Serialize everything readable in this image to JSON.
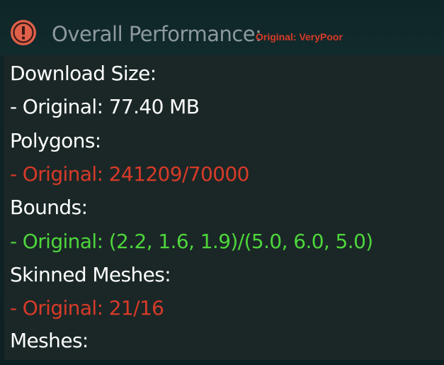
{
  "header": {
    "icon": "exclamation-circle-icon",
    "title": "Overall Performance:",
    "rating": "Original: VeryPoor",
    "rating_color": "#d83a28"
  },
  "stats": [
    {
      "label": "Download Size:",
      "value": "- Original: 77.40 MB",
      "value_color": "#ffffff"
    },
    {
      "label": "Polygons:",
      "value": "- Original: 241209/70000",
      "value_color": "#d83a28"
    },
    {
      "label": "Bounds:",
      "value": "- Original: (2.2, 1.6, 1.9)/(5.0, 6.0, 5.0)",
      "value_color": "#4ed63c"
    },
    {
      "label": "Skinned Meshes:",
      "value": "- Original: 21/16",
      "value_color": "#d83a28"
    },
    {
      "label": "Meshes:"
    }
  ]
}
